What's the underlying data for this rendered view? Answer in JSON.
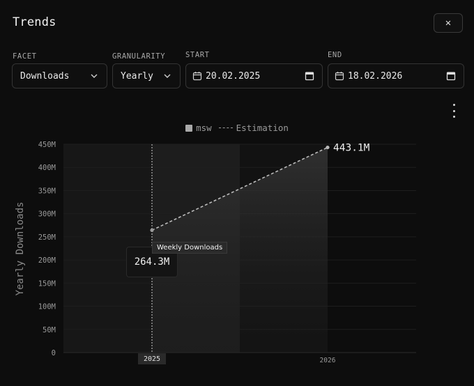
{
  "dialog": {
    "title": "Trends"
  },
  "filters": {
    "facet": {
      "label": "FACET",
      "value": "Downloads"
    },
    "granularity": {
      "label": "GRANULARITY",
      "value": "Yearly"
    },
    "start": {
      "label": "START",
      "value": "20.02.2025"
    },
    "end": {
      "label": "END",
      "value": "18.02.2026"
    }
  },
  "legend": {
    "series": "msw",
    "estimation": "Estimation"
  },
  "tooltip": {
    "label": "Weekly Downloads",
    "value": "264.3M"
  },
  "icons": {
    "close": "close-icon",
    "chevron": "chevron-down-icon",
    "calendar": "calendar-icon",
    "menu": "kebab-menu-icon"
  },
  "chart_data": {
    "type": "line",
    "ylabel": "Yearly Downloads",
    "ylim": [
      0,
      450000000
    ],
    "yticks": [
      0,
      50000000,
      100000000,
      150000000,
      200000000,
      250000000,
      300000000,
      350000000,
      400000000,
      450000000
    ],
    "ytick_labels": [
      "0",
      "50M",
      "100M",
      "150M",
      "200M",
      "250M",
      "300M",
      "350M",
      "400M",
      "450M"
    ],
    "x": [
      "2025",
      "2026"
    ],
    "series": [
      {
        "name": "msw",
        "values": [
          264300000,
          null
        ]
      },
      {
        "name": "Estimation",
        "values": [
          264300000,
          443100000
        ],
        "dashed": true
      }
    ],
    "point_labels": [
      "264.3M",
      "443.1M"
    ],
    "active_x": "2025",
    "grid": true,
    "colors": {
      "line": "#bdbdbd",
      "grid": "#1e1e1e",
      "band": "#1a1a1a",
      "axis": "#9a9a9a"
    }
  }
}
